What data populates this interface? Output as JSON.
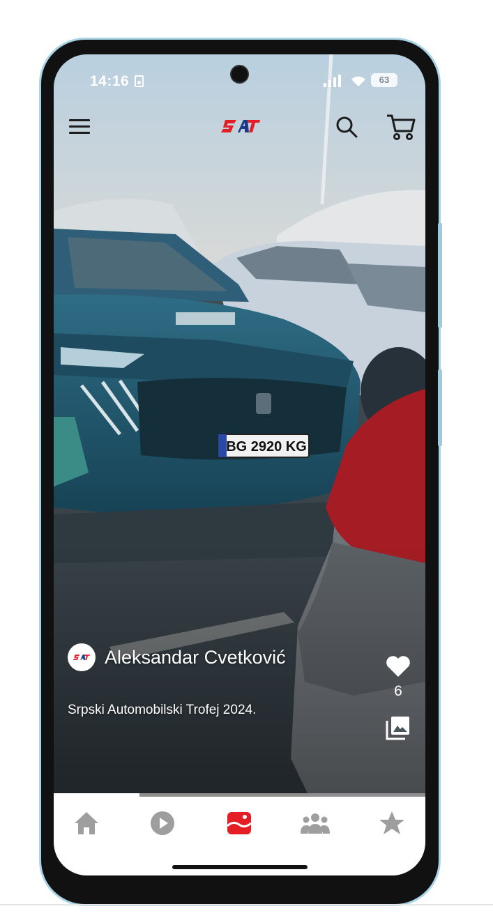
{
  "status_bar": {
    "time": "14:16",
    "battery": "63",
    "sim_icon": "sim-card-icon",
    "signal_icon": "cellular-signal-icon",
    "wifi_icon": "wifi-icon"
  },
  "header": {
    "logo_text": "SAT",
    "menu_icon": "hamburger-menu-icon",
    "search_icon": "search-icon",
    "cart_icon": "shopping-cart-icon"
  },
  "post": {
    "author_name": "Aleksandar Cvetković",
    "caption": "Srpski Automobilski Trofej 2024.",
    "like_count": "6",
    "progress": 0.23
  },
  "bottom_nav": {
    "items": [
      {
        "name": "home",
        "icon": "home-icon",
        "active": false
      },
      {
        "name": "play",
        "icon": "play-circle-icon",
        "active": false
      },
      {
        "name": "stories",
        "icon": "stories-icon",
        "active": true
      },
      {
        "name": "community",
        "icon": "users-icon",
        "active": false
      },
      {
        "name": "favorites",
        "icon": "star-icon",
        "active": false
      }
    ]
  },
  "colors": {
    "brand_red": "#e31e24",
    "brand_blue": "#1a3a8a",
    "nav_inactive": "#9e9e9e",
    "frame_accent": "#a9d3e6"
  }
}
